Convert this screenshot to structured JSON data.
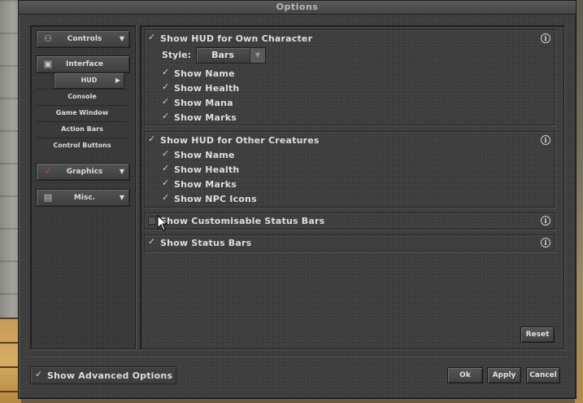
{
  "window": {
    "title": "Options"
  },
  "sidebar": {
    "categories": [
      {
        "label": "Controls",
        "icon": "controls-icon"
      },
      {
        "label": "Interface",
        "icon": "interface-icon"
      },
      {
        "label": "Graphics",
        "icon": "graphics-icon"
      },
      {
        "label": "Misc.",
        "icon": "misc-icon"
      }
    ],
    "interface_items": [
      "HUD",
      "Console",
      "Game Window",
      "Action Bars",
      "Control Buttons"
    ]
  },
  "hud": {
    "own": {
      "title": "Show HUD for Own Character",
      "checked": true,
      "style_label": "Style:",
      "style_value": "Bars",
      "options": [
        "Show Name",
        "Show Health",
        "Show Mana",
        "Show Marks"
      ]
    },
    "others": {
      "title": "Show HUD for Other Creatures",
      "checked": true,
      "options": [
        "Show Name",
        "Show Health",
        "Show Marks",
        "Show NPC Icons"
      ]
    },
    "custom_status": {
      "title": "Show Customisable Status Bars",
      "checked": false
    },
    "status_bars": {
      "title": "Show Status Bars",
      "checked": true
    },
    "info_glyph": "i"
  },
  "buttons": {
    "reset": "Reset",
    "ok": "Ok",
    "apply": "Apply",
    "cancel": "Cancel"
  },
  "footer": {
    "advanced_label": "Show Advanced Options",
    "advanced_checked": true
  }
}
